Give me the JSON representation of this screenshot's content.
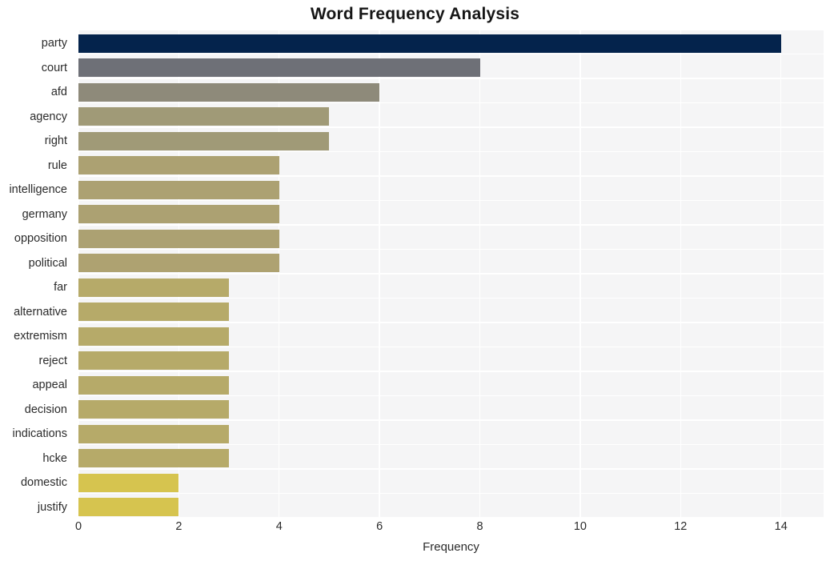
{
  "chart_data": {
    "type": "bar",
    "orientation": "horizontal",
    "title": "Word Frequency Analysis",
    "xlabel": "Frequency",
    "ylabel": "",
    "categories": [
      "party",
      "court",
      "afd",
      "agency",
      "right",
      "rule",
      "intelligence",
      "germany",
      "opposition",
      "political",
      "far",
      "alternative",
      "extremism",
      "reject",
      "appeal",
      "decision",
      "indications",
      "hcke",
      "domestic",
      "justify"
    ],
    "values": [
      14,
      8,
      6,
      5,
      5,
      4,
      4,
      4,
      4,
      4,
      3,
      3,
      3,
      3,
      3,
      3,
      3,
      3,
      2,
      2
    ],
    "bar_colors": [
      "#04234c",
      "#6e7077",
      "#8e8a7a",
      "#a09a77",
      "#a09a77",
      "#aca172",
      "#aca172",
      "#aca172",
      "#aca172",
      "#aea271",
      "#b6aa69",
      "#b6aa69",
      "#b6aa69",
      "#b6aa69",
      "#b6aa69",
      "#b6aa69",
      "#b6aa69",
      "#b6aa69",
      "#d6c44f",
      "#d6c44f"
    ],
    "xlim": [
      0,
      14.85
    ],
    "xticks": [
      0,
      2,
      4,
      6,
      8,
      10,
      12,
      14
    ],
    "xtick_labels": [
      "0",
      "2",
      "4",
      "6",
      "8",
      "10",
      "12",
      "14"
    ],
    "grid": true,
    "grid_color": "#ffffff",
    "plot_background": "#f5f5f6",
    "figure_background": "#ffffff",
    "legend": null
  }
}
